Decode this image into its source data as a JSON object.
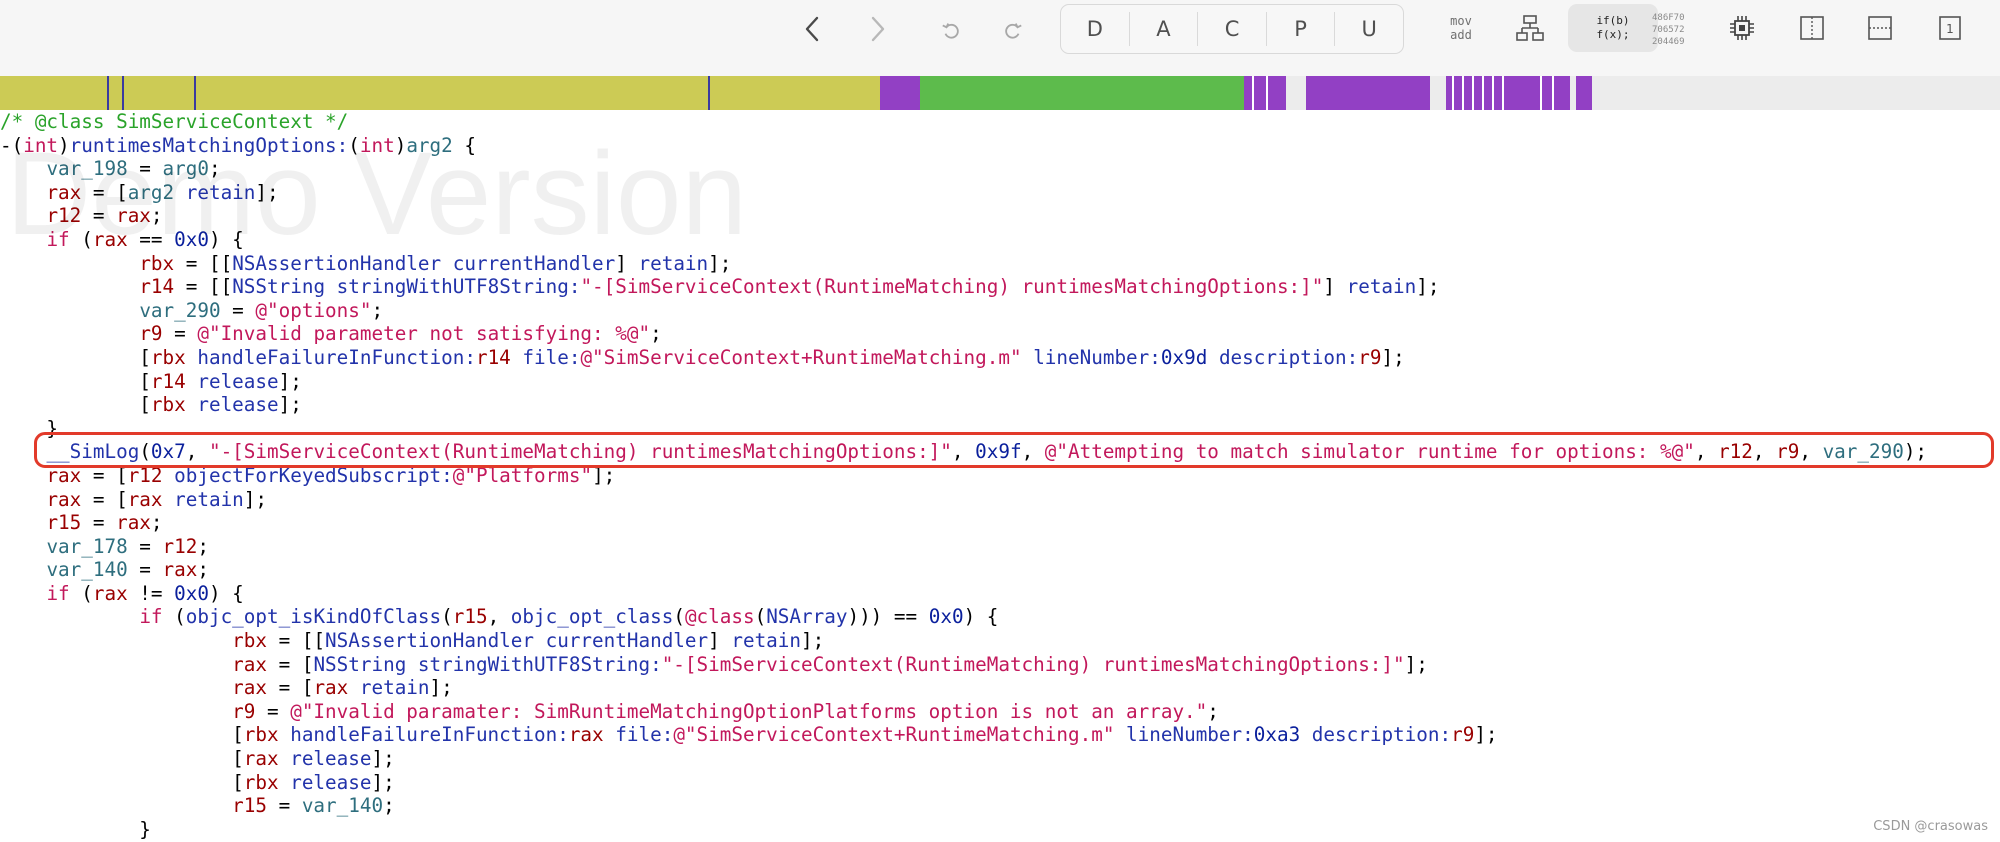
{
  "toolbar": {
    "back_icon": "chevron-left-icon",
    "forward_icon": "chevron-right-icon",
    "undo_icon": "undo-icon",
    "redo_icon": "redo-icon",
    "segments": [
      "D",
      "A",
      "C",
      "P",
      "U"
    ],
    "asm_mode_top": "mov",
    "asm_mode_bottom": "add",
    "cfg_icon": "control-flow-graph-icon",
    "pseudo_top": "if(b)",
    "pseudo_bottom": "f(x);",
    "hex_lines": [
      "486F70",
      "706572",
      "204469"
    ],
    "cpu_icon": "cpu-icon",
    "split_vertical_icon": "split-vertical-icon",
    "split_horizontal_icon": "split-horizontal-icon",
    "page_badge": "1"
  },
  "nav_band": {
    "segments": [
      {
        "color": "#cccb55"
      },
      {
        "color": "#9240c4"
      },
      {
        "color": "#5dbb4c"
      },
      {
        "color": "#9240c4"
      },
      {
        "color": "#ececec"
      }
    ]
  },
  "code": {
    "watermark": "Demo Version",
    "lines": [
      [
        [
          "c",
          "/* @class SimServiceContext */"
        ]
      ],
      [
        [
          "p",
          "-("
        ],
        [
          "k",
          "int"
        ],
        [
          "p",
          ")"
        ],
        [
          "f",
          "runtimesMatchingOptions:"
        ],
        [
          "p",
          "("
        ],
        [
          "k",
          "int"
        ],
        [
          "p",
          ")"
        ],
        [
          "v",
          "arg2"
        ],
        [
          "p",
          " {"
        ]
      ],
      [
        [
          "p",
          "    "
        ],
        [
          "v",
          "var_198"
        ],
        [
          "p",
          " = "
        ],
        [
          "v",
          "arg0"
        ],
        [
          "p",
          ";"
        ]
      ],
      [
        [
          "p",
          "    "
        ],
        [
          "r",
          "rax"
        ],
        [
          "p",
          " = ["
        ],
        [
          "v",
          "arg2"
        ],
        [
          "p",
          " "
        ],
        [
          "f",
          "retain"
        ],
        [
          "p",
          "];"
        ]
      ],
      [
        [
          "p",
          "    "
        ],
        [
          "r",
          "r12"
        ],
        [
          "p",
          " = "
        ],
        [
          "r",
          "rax"
        ],
        [
          "p",
          ";"
        ]
      ],
      [
        [
          "p",
          "    "
        ],
        [
          "k",
          "if"
        ],
        [
          "p",
          " ("
        ],
        [
          "r",
          "rax"
        ],
        [
          "p",
          " == "
        ],
        [
          "n",
          "0x0"
        ],
        [
          "p",
          ") {"
        ]
      ],
      [
        [
          "p",
          "            "
        ],
        [
          "r",
          "rbx"
        ],
        [
          "p",
          " = [["
        ],
        [
          "f",
          "NSAssertionHandler"
        ],
        [
          "p",
          " "
        ],
        [
          "f",
          "currentHandler"
        ],
        [
          "p",
          "] "
        ],
        [
          "f",
          "retain"
        ],
        [
          "p",
          "];"
        ]
      ],
      [
        [
          "p",
          "            "
        ],
        [
          "r",
          "r14"
        ],
        [
          "p",
          " = [["
        ],
        [
          "f",
          "NSString"
        ],
        [
          "p",
          " "
        ],
        [
          "f",
          "stringWithUTF8String:"
        ],
        [
          "s",
          "\"-[SimServiceContext(RuntimeMatching) runtimesMatchingOptions:]\""
        ],
        [
          "p",
          "] "
        ],
        [
          "f",
          "retain"
        ],
        [
          "p",
          "];"
        ]
      ],
      [
        [
          "p",
          "            "
        ],
        [
          "v",
          "var_290"
        ],
        [
          "p",
          " = "
        ],
        [
          "s",
          "@\"options\""
        ],
        [
          "p",
          ";"
        ]
      ],
      [
        [
          "p",
          "            "
        ],
        [
          "r",
          "r9"
        ],
        [
          "p",
          " = "
        ],
        [
          "s",
          "@\"Invalid parameter not satisfying: %@\""
        ],
        [
          "p",
          ";"
        ]
      ],
      [
        [
          "p",
          "            ["
        ],
        [
          "r",
          "rbx"
        ],
        [
          "p",
          " "
        ],
        [
          "f",
          "handleFailureInFunction:"
        ],
        [
          "r",
          "r14"
        ],
        [
          "p",
          " "
        ],
        [
          "f",
          "file:"
        ],
        [
          "s",
          "@\"SimServiceContext+RuntimeMatching.m\""
        ],
        [
          "p",
          " "
        ],
        [
          "f",
          "lineNumber:"
        ],
        [
          "n",
          "0x9d"
        ],
        [
          "p",
          " "
        ],
        [
          "f",
          "description:"
        ],
        [
          "r",
          "r9"
        ],
        [
          "p",
          "];"
        ]
      ],
      [
        [
          "p",
          "            ["
        ],
        [
          "r",
          "r14"
        ],
        [
          "p",
          " "
        ],
        [
          "f",
          "release"
        ],
        [
          "p",
          "];"
        ]
      ],
      [
        [
          "p",
          "            ["
        ],
        [
          "r",
          "rbx"
        ],
        [
          "p",
          " "
        ],
        [
          "f",
          "release"
        ],
        [
          "p",
          "];"
        ]
      ],
      [
        [
          "p",
          "    }"
        ]
      ],
      [
        [
          "p",
          "    "
        ],
        [
          "f",
          "__SimLog"
        ],
        [
          "p",
          "("
        ],
        [
          "n",
          "0x7"
        ],
        [
          "p",
          ", "
        ],
        [
          "s",
          "\"-[SimServiceContext(RuntimeMatching) runtimesMatchingOptions:]\""
        ],
        [
          "p",
          ", "
        ],
        [
          "n",
          "0x9f"
        ],
        [
          "p",
          ", "
        ],
        [
          "s",
          "@\"Attempting to match simulator runtime for options: %@\""
        ],
        [
          "p",
          ", "
        ],
        [
          "r",
          "r12"
        ],
        [
          "p",
          ", "
        ],
        [
          "r",
          "r9"
        ],
        [
          "p",
          ", "
        ],
        [
          "v",
          "var_290"
        ],
        [
          "p",
          ");"
        ]
      ],
      [
        [
          "p",
          "    "
        ],
        [
          "r",
          "rax"
        ],
        [
          "p",
          " = ["
        ],
        [
          "r",
          "r12"
        ],
        [
          "p",
          " "
        ],
        [
          "f",
          "objectForKeyedSubscript:"
        ],
        [
          "s",
          "@\"Platforms\""
        ],
        [
          "p",
          "];"
        ]
      ],
      [
        [
          "p",
          "    "
        ],
        [
          "r",
          "rax"
        ],
        [
          "p",
          " = ["
        ],
        [
          "r",
          "rax"
        ],
        [
          "p",
          " "
        ],
        [
          "f",
          "retain"
        ],
        [
          "p",
          "];"
        ]
      ],
      [
        [
          "p",
          "    "
        ],
        [
          "r",
          "r15"
        ],
        [
          "p",
          " = "
        ],
        [
          "r",
          "rax"
        ],
        [
          "p",
          ";"
        ]
      ],
      [
        [
          "p",
          "    "
        ],
        [
          "v",
          "var_178"
        ],
        [
          "p",
          " = "
        ],
        [
          "r",
          "r12"
        ],
        [
          "p",
          ";"
        ]
      ],
      [
        [
          "p",
          "    "
        ],
        [
          "v",
          "var_140"
        ],
        [
          "p",
          " = "
        ],
        [
          "r",
          "rax"
        ],
        [
          "p",
          ";"
        ]
      ],
      [
        [
          "p",
          "    "
        ],
        [
          "k",
          "if"
        ],
        [
          "p",
          " ("
        ],
        [
          "r",
          "rax"
        ],
        [
          "p",
          " != "
        ],
        [
          "n",
          "0x0"
        ],
        [
          "p",
          ") {"
        ]
      ],
      [
        [
          "p",
          "            "
        ],
        [
          "k",
          "if"
        ],
        [
          "p",
          " ("
        ],
        [
          "f",
          "objc_opt_isKindOfClass"
        ],
        [
          "p",
          "("
        ],
        [
          "r",
          "r15"
        ],
        [
          "p",
          ", "
        ],
        [
          "f",
          "objc_opt_class"
        ],
        [
          "p",
          "("
        ],
        [
          "k",
          "@class"
        ],
        [
          "p",
          "("
        ],
        [
          "f",
          "NSArray"
        ],
        [
          "p",
          "))) == "
        ],
        [
          "n",
          "0x0"
        ],
        [
          "p",
          ") {"
        ]
      ],
      [
        [
          "p",
          "                    "
        ],
        [
          "r",
          "rbx"
        ],
        [
          "p",
          " = [["
        ],
        [
          "f",
          "NSAssertionHandler"
        ],
        [
          "p",
          " "
        ],
        [
          "f",
          "currentHandler"
        ],
        [
          "p",
          "] "
        ],
        [
          "f",
          "retain"
        ],
        [
          "p",
          "];"
        ]
      ],
      [
        [
          "p",
          "                    "
        ],
        [
          "r",
          "rax"
        ],
        [
          "p",
          " = ["
        ],
        [
          "f",
          "NSString"
        ],
        [
          "p",
          " "
        ],
        [
          "f",
          "stringWithUTF8String:"
        ],
        [
          "s",
          "\"-[SimServiceContext(RuntimeMatching) runtimesMatchingOptions:]\""
        ],
        [
          "p",
          "];"
        ]
      ],
      [
        [
          "p",
          "                    "
        ],
        [
          "r",
          "rax"
        ],
        [
          "p",
          " = ["
        ],
        [
          "r",
          "rax"
        ],
        [
          "p",
          " "
        ],
        [
          "f",
          "retain"
        ],
        [
          "p",
          "];"
        ]
      ],
      [
        [
          "p",
          "                    "
        ],
        [
          "r",
          "r9"
        ],
        [
          "p",
          " = "
        ],
        [
          "s",
          "@\"Invalid paramater: SimRuntimeMatchingOptionPlatforms option is not an array.\""
        ],
        [
          "p",
          ";"
        ]
      ],
      [
        [
          "p",
          "                    ["
        ],
        [
          "r",
          "rbx"
        ],
        [
          "p",
          " "
        ],
        [
          "f",
          "handleFailureInFunction:"
        ],
        [
          "r",
          "rax"
        ],
        [
          "p",
          " "
        ],
        [
          "f",
          "file:"
        ],
        [
          "s",
          "@\"SimServiceContext+RuntimeMatching.m\""
        ],
        [
          "p",
          " "
        ],
        [
          "f",
          "lineNumber:"
        ],
        [
          "n",
          "0xa3"
        ],
        [
          "p",
          " "
        ],
        [
          "f",
          "description:"
        ],
        [
          "r",
          "r9"
        ],
        [
          "p",
          "];"
        ]
      ],
      [
        [
          "p",
          "                    ["
        ],
        [
          "r",
          "rax"
        ],
        [
          "p",
          " "
        ],
        [
          "f",
          "release"
        ],
        [
          "p",
          "];"
        ]
      ],
      [
        [
          "p",
          "                    ["
        ],
        [
          "r",
          "rbx"
        ],
        [
          "p",
          " "
        ],
        [
          "f",
          "release"
        ],
        [
          "p",
          "];"
        ]
      ],
      [
        [
          "p",
          "                    "
        ],
        [
          "r",
          "r15"
        ],
        [
          "p",
          " = "
        ],
        [
          "v",
          "var_140"
        ],
        [
          "p",
          ";"
        ]
      ],
      [
        [
          "p",
          "            }"
        ]
      ]
    ]
  },
  "credit": "CSDN @crasowas"
}
